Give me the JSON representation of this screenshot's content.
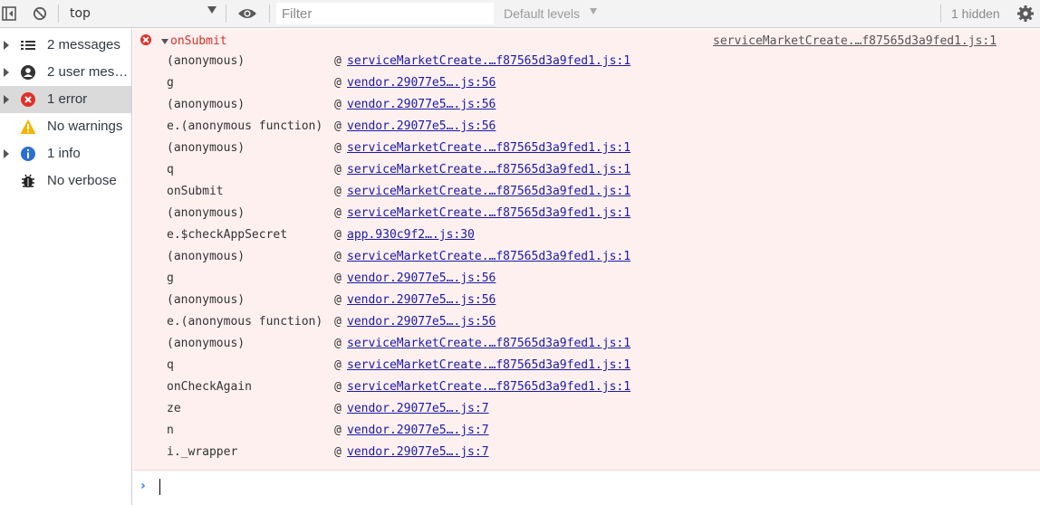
{
  "toolbar": {
    "context": "top",
    "filter_placeholder": "Filter",
    "levels_label": "Default levels",
    "hidden_label": "1 hidden",
    "icons": [
      "dock-sidebar-icon",
      "clear-console-icon",
      "chevron-down-icon",
      "eye-icon",
      "gear-icon"
    ]
  },
  "sidebar": {
    "items": [
      {
        "label": "2 messages",
        "icon": "list-icon",
        "expandable": true,
        "selected": false
      },
      {
        "label": "2 user messages",
        "icon": "user-icon",
        "expandable": true,
        "selected": false
      },
      {
        "label": "1 error",
        "icon": "error-icon",
        "expandable": true,
        "selected": true
      },
      {
        "label": "No warnings",
        "icon": "warning-icon",
        "expandable": false,
        "selected": false
      },
      {
        "label": "1 info",
        "icon": "info-icon",
        "expandable": true,
        "selected": false
      },
      {
        "label": "No verbose",
        "icon": "bug-icon",
        "expandable": false,
        "selected": false
      }
    ]
  },
  "console": {
    "error": {
      "title": "onSubmit",
      "source": "serviceMarketCreate.…f87565d3a9fed1.js:1",
      "frames": [
        {
          "fn": "(anonymous)",
          "loc": "serviceMarketCreate.…f87565d3a9fed1.js:1"
        },
        {
          "fn": "g",
          "loc": "vendor.29077e5….js:56"
        },
        {
          "fn": "(anonymous)",
          "loc": "vendor.29077e5….js:56"
        },
        {
          "fn": "e.(anonymous function)",
          "loc": "vendor.29077e5….js:56"
        },
        {
          "fn": "(anonymous)",
          "loc": "serviceMarketCreate.…f87565d3a9fed1.js:1"
        },
        {
          "fn": "q",
          "loc": "serviceMarketCreate.…f87565d3a9fed1.js:1"
        },
        {
          "fn": "onSubmit",
          "loc": "serviceMarketCreate.…f87565d3a9fed1.js:1"
        },
        {
          "fn": "(anonymous)",
          "loc": "serviceMarketCreate.…f87565d3a9fed1.js:1"
        },
        {
          "fn": "e.$checkAppSecret",
          "loc": "app.930c9f2….js:30"
        },
        {
          "fn": "(anonymous)",
          "loc": "serviceMarketCreate.…f87565d3a9fed1.js:1"
        },
        {
          "fn": "g",
          "loc": "vendor.29077e5….js:56"
        },
        {
          "fn": "(anonymous)",
          "loc": "vendor.29077e5….js:56"
        },
        {
          "fn": "e.(anonymous function)",
          "loc": "vendor.29077e5….js:56"
        },
        {
          "fn": "(anonymous)",
          "loc": "serviceMarketCreate.…f87565d3a9fed1.js:1"
        },
        {
          "fn": "q",
          "loc": "serviceMarketCreate.…f87565d3a9fed1.js:1"
        },
        {
          "fn": "onCheckAgain",
          "loc": "serviceMarketCreate.…f87565d3a9fed1.js:1"
        },
        {
          "fn": "ze",
          "loc": "vendor.29077e5….js:7"
        },
        {
          "fn": "n",
          "loc": "vendor.29077e5….js:7"
        },
        {
          "fn": "i._wrapper",
          "loc": "vendor.29077e5….js:7"
        }
      ],
      "at_symbol": "@"
    },
    "prompt_symbol": "›"
  },
  "colors": {
    "error_red": "#d93025",
    "link_blue": "#1a1aa6",
    "error_bg": "#fff0f0",
    "toolbar_bg": "#f3f3f3",
    "prompt_blue": "#367cf1"
  }
}
